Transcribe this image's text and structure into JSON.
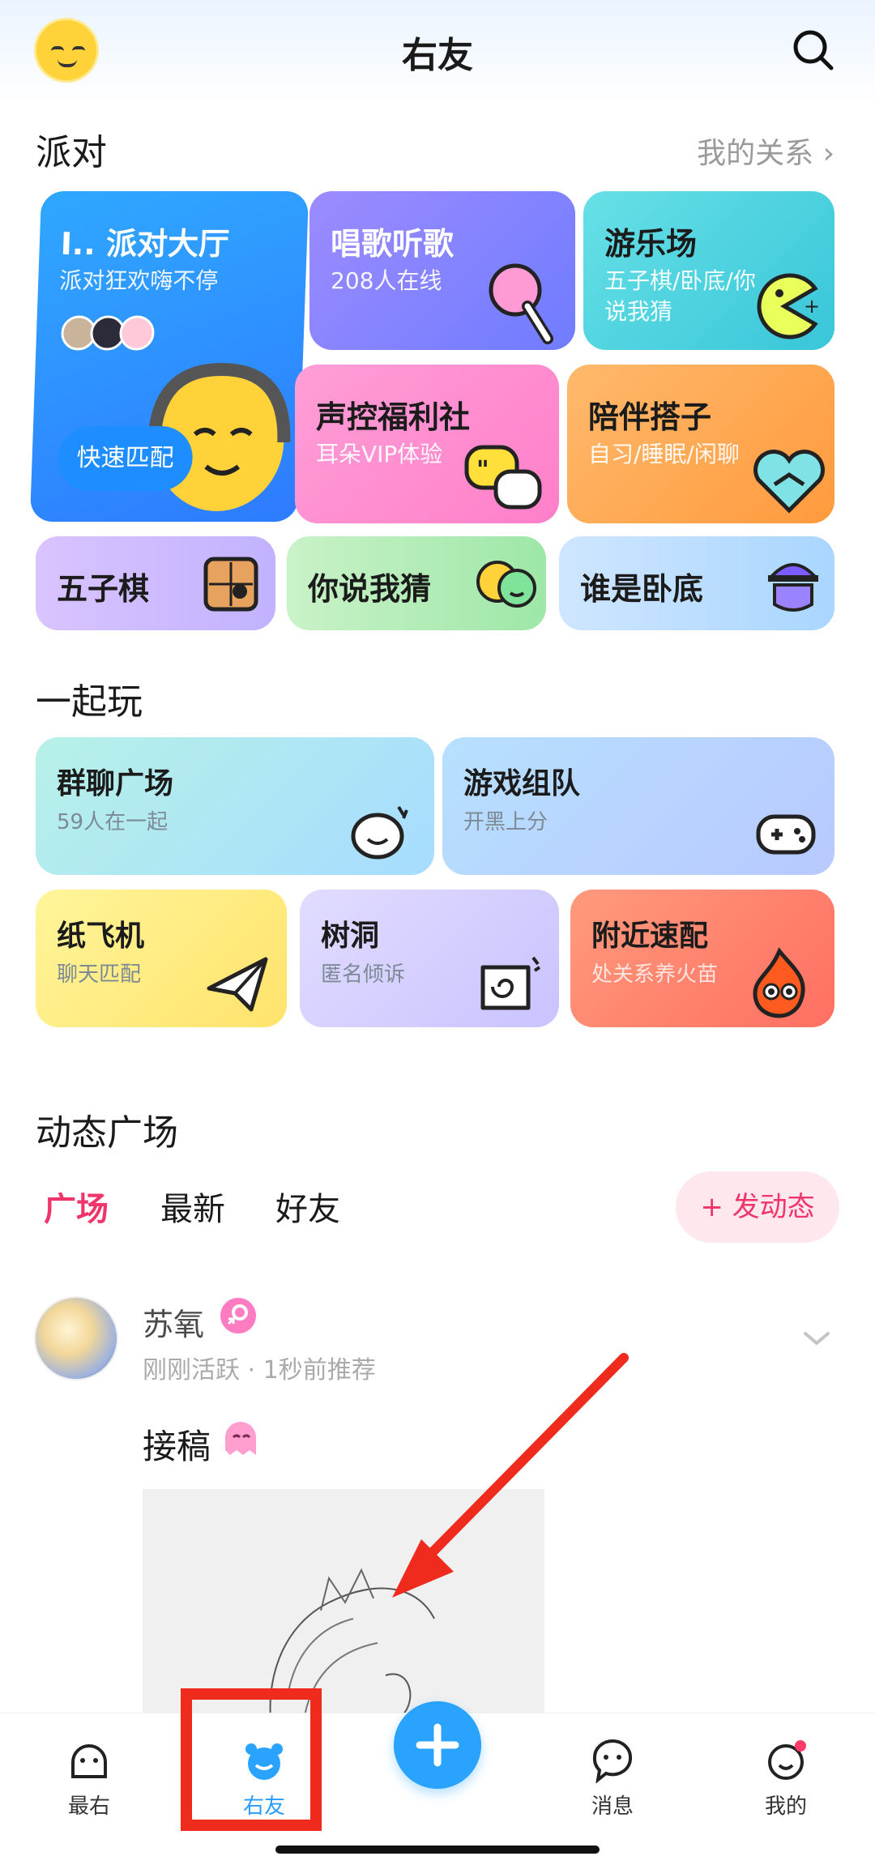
{
  "header": {
    "title": "右友"
  },
  "party": {
    "title": "派对",
    "relations_link": "我的关系 ›",
    "cards": [
      {
        "title": "I.. 派对大厅",
        "subtitle": "派对狂欢嗨不停",
        "button": "快速匹配"
      },
      {
        "title": "唱歌听歌",
        "subtitle": "208人在线"
      },
      {
        "title": "游乐场",
        "subtitle": "五子棋/卧底/你说我猜"
      },
      {
        "title": "声控福利社",
        "subtitle": "耳朵VIP体验"
      },
      {
        "title": "陪伴搭子",
        "subtitle": "自习/睡眠/闲聊"
      }
    ],
    "small_cards": [
      {
        "title": "五子棋"
      },
      {
        "title": "你说我猜"
      },
      {
        "title": "谁是卧底"
      }
    ]
  },
  "play": {
    "title": "一起玩",
    "cards": [
      {
        "title": "群聊广场",
        "subtitle": "59人在一起"
      },
      {
        "title": "游戏组队",
        "subtitle": "开黑上分"
      },
      {
        "title": "纸飞机",
        "subtitle": "聊天匹配"
      },
      {
        "title": "树洞",
        "subtitle": "匿名倾诉"
      },
      {
        "title": "附近速配",
        "subtitle": "处关系养火苗"
      }
    ]
  },
  "feed": {
    "title": "动态广场",
    "tabs": [
      "广场",
      "最新",
      "好友"
    ],
    "active_tab": "广场",
    "post_button": "+ 发动态",
    "post": {
      "username": "苏氧",
      "meta": "刚刚活跃 · 1秒前推荐",
      "text": "接稿"
    }
  },
  "nav": {
    "items": [
      {
        "label": "最右",
        "icon": "face-icon"
      },
      {
        "label": "右友",
        "icon": "bear-icon"
      },
      {
        "label": "消息",
        "icon": "chat-bubble-icon"
      },
      {
        "label": "我的",
        "icon": "profile-icon"
      }
    ],
    "active": "右友"
  },
  "colors": {
    "accent_pink": "#f0356a",
    "accent_blue": "#2aa3ff",
    "annotation_red": "#ee2b1c"
  }
}
